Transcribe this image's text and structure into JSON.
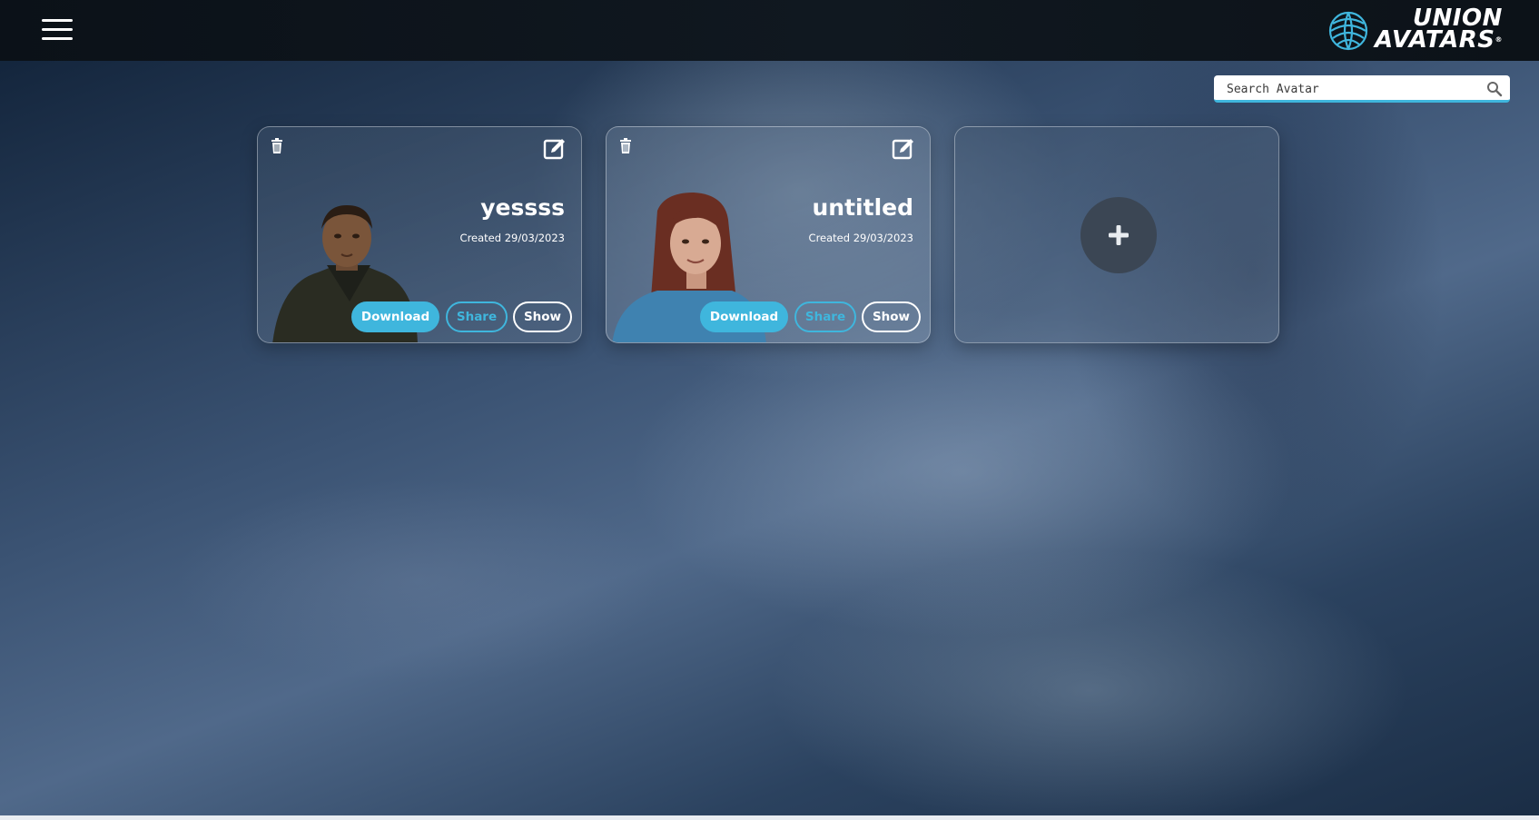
{
  "header": {
    "menu_icon": "hamburger-menu-icon",
    "logo": {
      "line1": "UNION",
      "line2": "AVATARS",
      "registered": "®",
      "accent_color": "#3fb6dd"
    }
  },
  "search": {
    "placeholder": "Search Avatar",
    "value": "",
    "icon": "search-icon"
  },
  "avatars": [
    {
      "name": "yessss",
      "created": "Created 29/03/2023",
      "actions": {
        "download": "Download",
        "share": "Share",
        "show": "Show"
      }
    },
    {
      "name": "untitled",
      "created": "Created 29/03/2023",
      "actions": {
        "download": "Download",
        "share": "Share",
        "show": "Show"
      }
    }
  ],
  "add_card": {
    "icon": "plus-icon"
  },
  "colors": {
    "accent": "#3fb6dd",
    "topbar": "#0e151d",
    "add_button": "#3b4654"
  }
}
